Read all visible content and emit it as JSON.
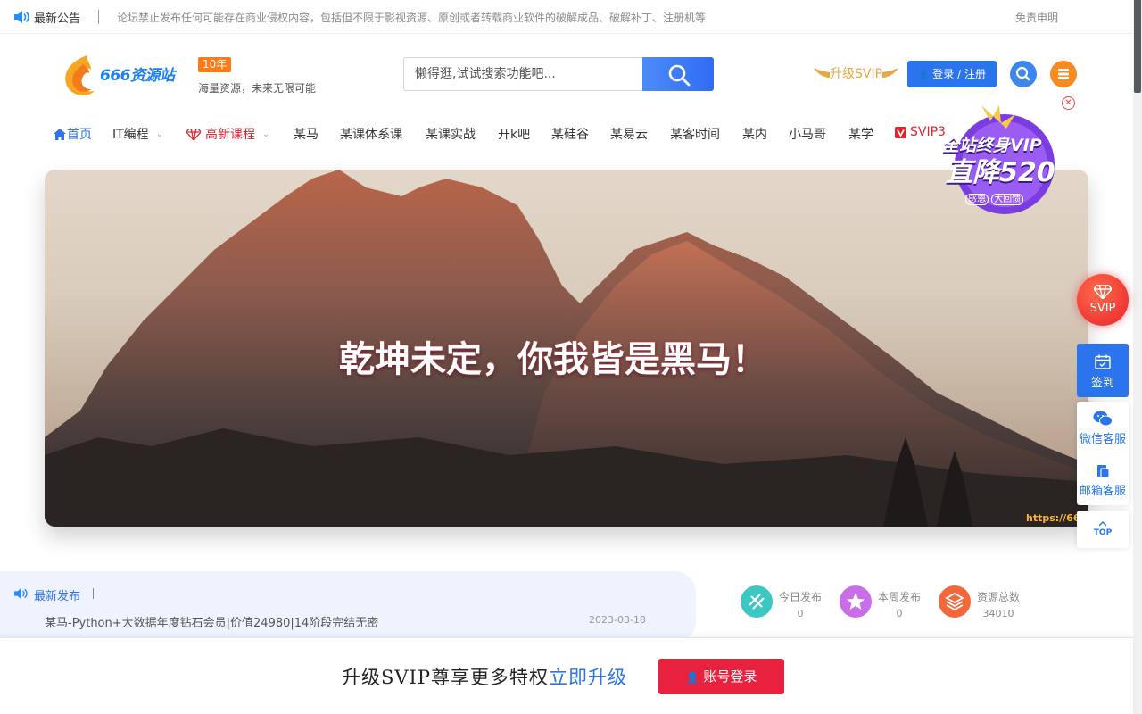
{
  "notice": {
    "title": "最新公告",
    "text": "论坛禁止发布任何可能存在商业侵权内容，包括但不限于影视资源、原创或者转载商业软件的破解成品、破解补丁、注册机等",
    "disclaimer": "免责申明"
  },
  "header": {
    "logo_text": "666资源站",
    "years_badge": "10年",
    "slogan": "海量资源，未来无限可能",
    "search_placeholder": "懒得逛,试试搜索功能吧...",
    "upgrade_svip": "升级SVIP",
    "login_label": "登录 / 注册"
  },
  "nav": {
    "items": [
      {
        "label": "首页"
      },
      {
        "label": "IT编程"
      },
      {
        "label": "高新课程"
      },
      {
        "label": "某马"
      },
      {
        "label": "某课体系课"
      },
      {
        "label": "某课实战"
      },
      {
        "label": "开k吧"
      },
      {
        "label": "某硅谷"
      },
      {
        "label": "某易云"
      },
      {
        "label": "某客时间"
      },
      {
        "label": "某内"
      },
      {
        "label": "小马哥"
      },
      {
        "label": "某学"
      },
      {
        "label": "SVIP3"
      }
    ]
  },
  "promo": {
    "line1": "全站终身VIP",
    "line2": "直降520",
    "tag1": "感恩",
    "tag2": "大回馈"
  },
  "banner": {
    "headline": "乾坤未定，你我皆是黑马！",
    "url": "https://66"
  },
  "sidebar": {
    "svip": "SVIP",
    "checkin": "签到",
    "wechat": "微信客服",
    "email": "邮箱客服",
    "top": "TOP"
  },
  "latest": {
    "title": "最新发布",
    "item_title": "某马-Python+大数据年度钻石会员|价值24980|14阶段完结无密",
    "item_date": "2023-03-18"
  },
  "stats": {
    "today_label": "今日发布",
    "today_value": "0",
    "week_label": "本周发布",
    "week_value": "0",
    "total_label": "资源总数",
    "total_value": "34010"
  },
  "bottom": {
    "text": "升级SVIP尊享更多特权",
    "link": "立即升级",
    "account_btn": "账号登录"
  },
  "colors": {
    "primary": "#2a74ee",
    "hot": "#e0232d",
    "gold": "#e7a843",
    "orange": "#f88a1f"
  }
}
